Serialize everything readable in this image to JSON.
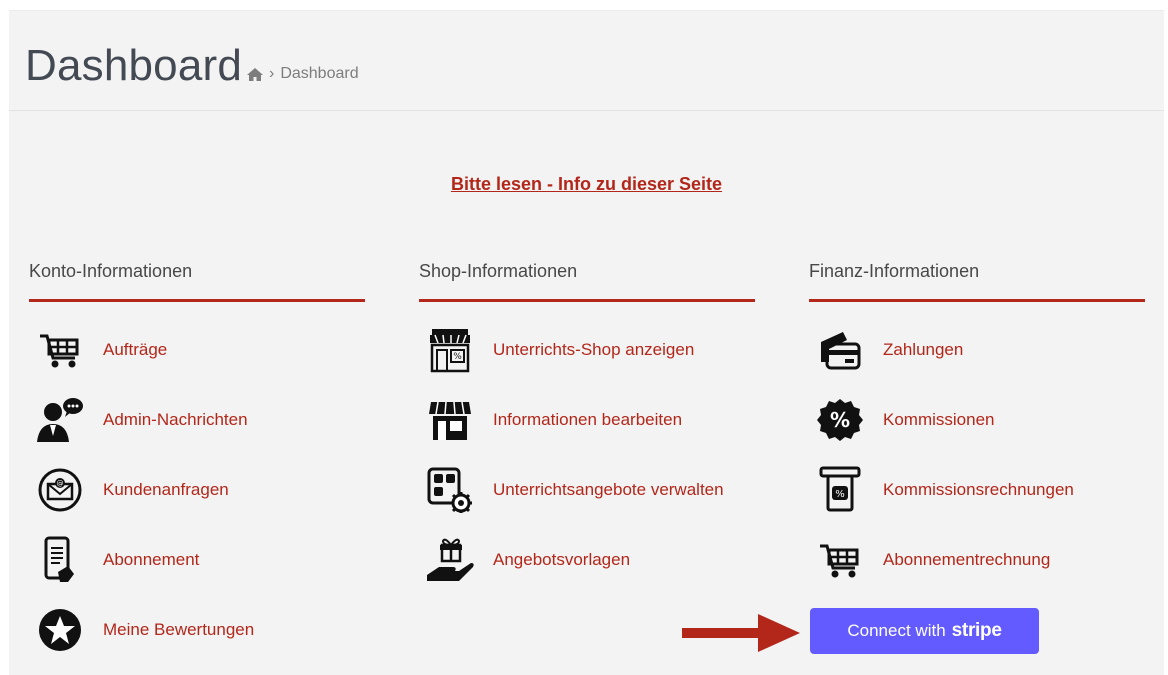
{
  "header": {
    "title": "Dashboard",
    "breadcrumb_home_icon": "home-icon",
    "breadcrumb_separator": "›",
    "breadcrumb_current": "Dashboard"
  },
  "info_link": "Bitte lesen - Info zu dieser Seite",
  "columns": [
    {
      "heading": "Konto-Informationen",
      "items": [
        {
          "label": "Aufträge",
          "icon": "shopping-cart-icon"
        },
        {
          "label": "Admin-Nachrichten",
          "icon": "admin-message-icon"
        },
        {
          "label": "Kundenanfragen",
          "icon": "mail-at-icon"
        },
        {
          "label": "Abonnement",
          "icon": "phone-document-icon"
        },
        {
          "label": "Meine Bewertungen",
          "icon": "star-badge-icon"
        }
      ]
    },
    {
      "heading": "Shop-Informationen",
      "items": [
        {
          "label": "Unterrichts-Shop anzeigen",
          "icon": "storefront-icon"
        },
        {
          "label": "Informationen bearbeiten",
          "icon": "store-edit-icon"
        },
        {
          "label": "Unterrichtsangebote verwalten",
          "icon": "grid-gear-icon"
        },
        {
          "label": "Angebotsvorlagen",
          "icon": "gift-hand-icon"
        }
      ]
    },
    {
      "heading": "Finanz-Informationen",
      "items": [
        {
          "label": "Zahlungen",
          "icon": "credit-card-icon"
        },
        {
          "label": "Kommissionen",
          "icon": "percent-badge-icon"
        },
        {
          "label": "Kommissionsrechnungen",
          "icon": "receipt-percent-icon"
        },
        {
          "label": "Abonnementrechnung",
          "icon": "shopping-cart-icon"
        }
      ]
    }
  ],
  "stripe_button": {
    "prefix": "Connect with",
    "brand": "stripe"
  },
  "colors": {
    "accent": "#b3271a",
    "stripe": "#635bff",
    "panel_bg": "#f3f3f3"
  }
}
